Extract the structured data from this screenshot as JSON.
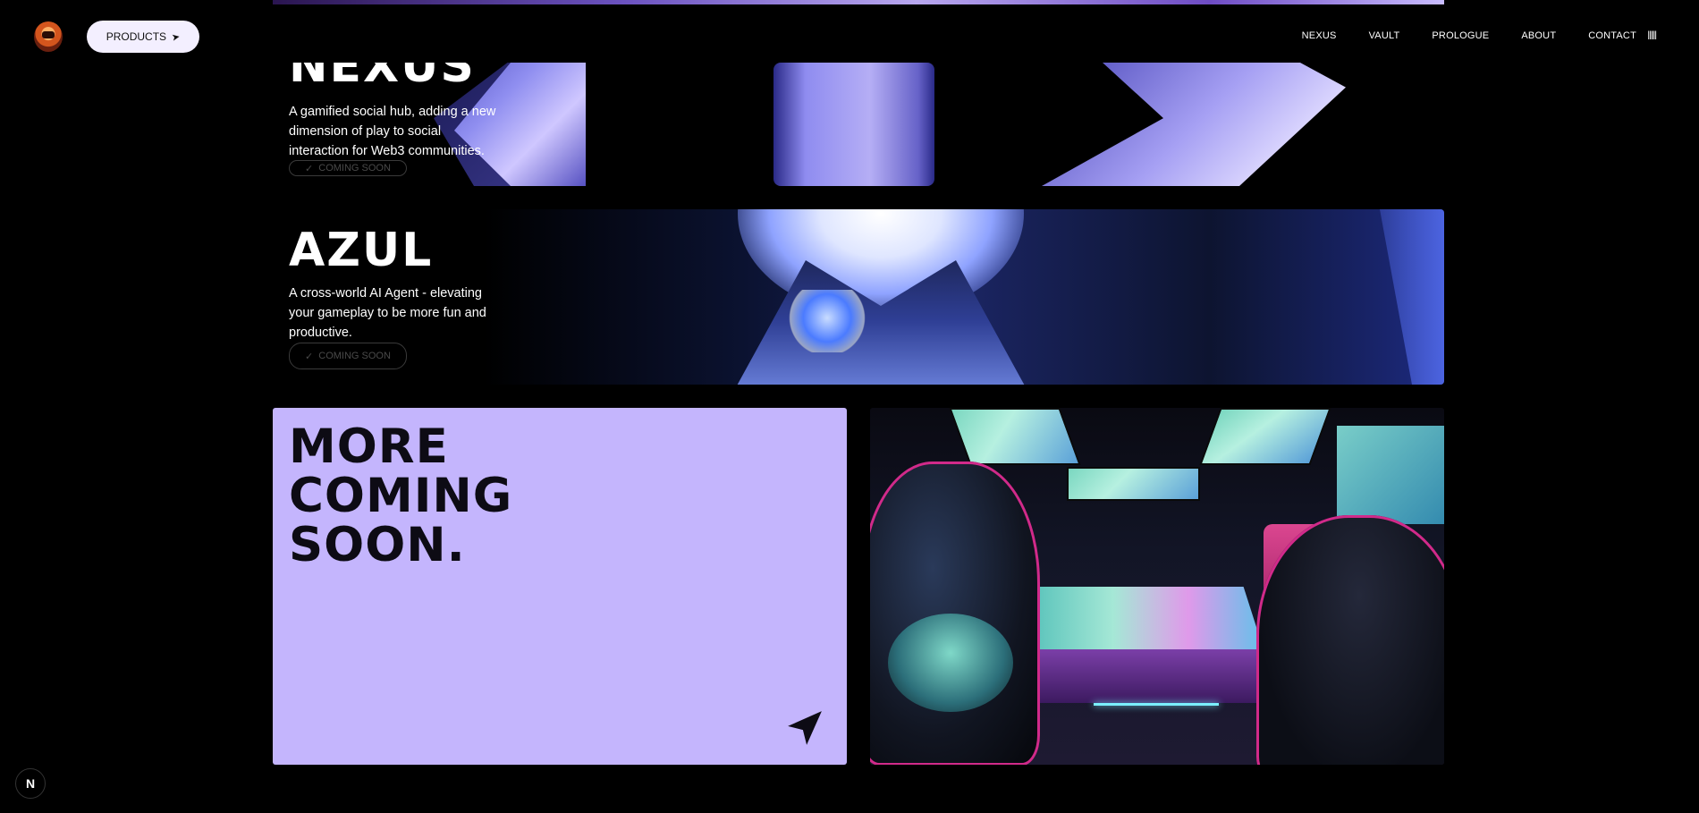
{
  "header": {
    "products_label": "PRODUCTS",
    "products_icon": "arrow-icon",
    "nav": [
      "NEXUS",
      "VAULT",
      "PROLOGUE",
      "ABOUT",
      "CONTACT"
    ],
    "menu_icon": "menu-dots-icon"
  },
  "products": [
    {
      "title": "NEXUS",
      "description": "A gamified social hub, adding a new dimension of play to social interaction for Web3 communities.",
      "status": "COMING SOON"
    },
    {
      "title": "AZUL",
      "description": "A cross-world AI Agent - elevating your gameplay to be more fun and productive.",
      "status": "COMING SOON"
    }
  ],
  "more": {
    "title": "MORE\nCOMING\nSOON.",
    "icon": "send-icon"
  },
  "badge": {
    "label": "N"
  },
  "colors": {
    "accent_purple": "#c4b5fd",
    "background": "#000000",
    "button_bg": "#f3efff"
  }
}
